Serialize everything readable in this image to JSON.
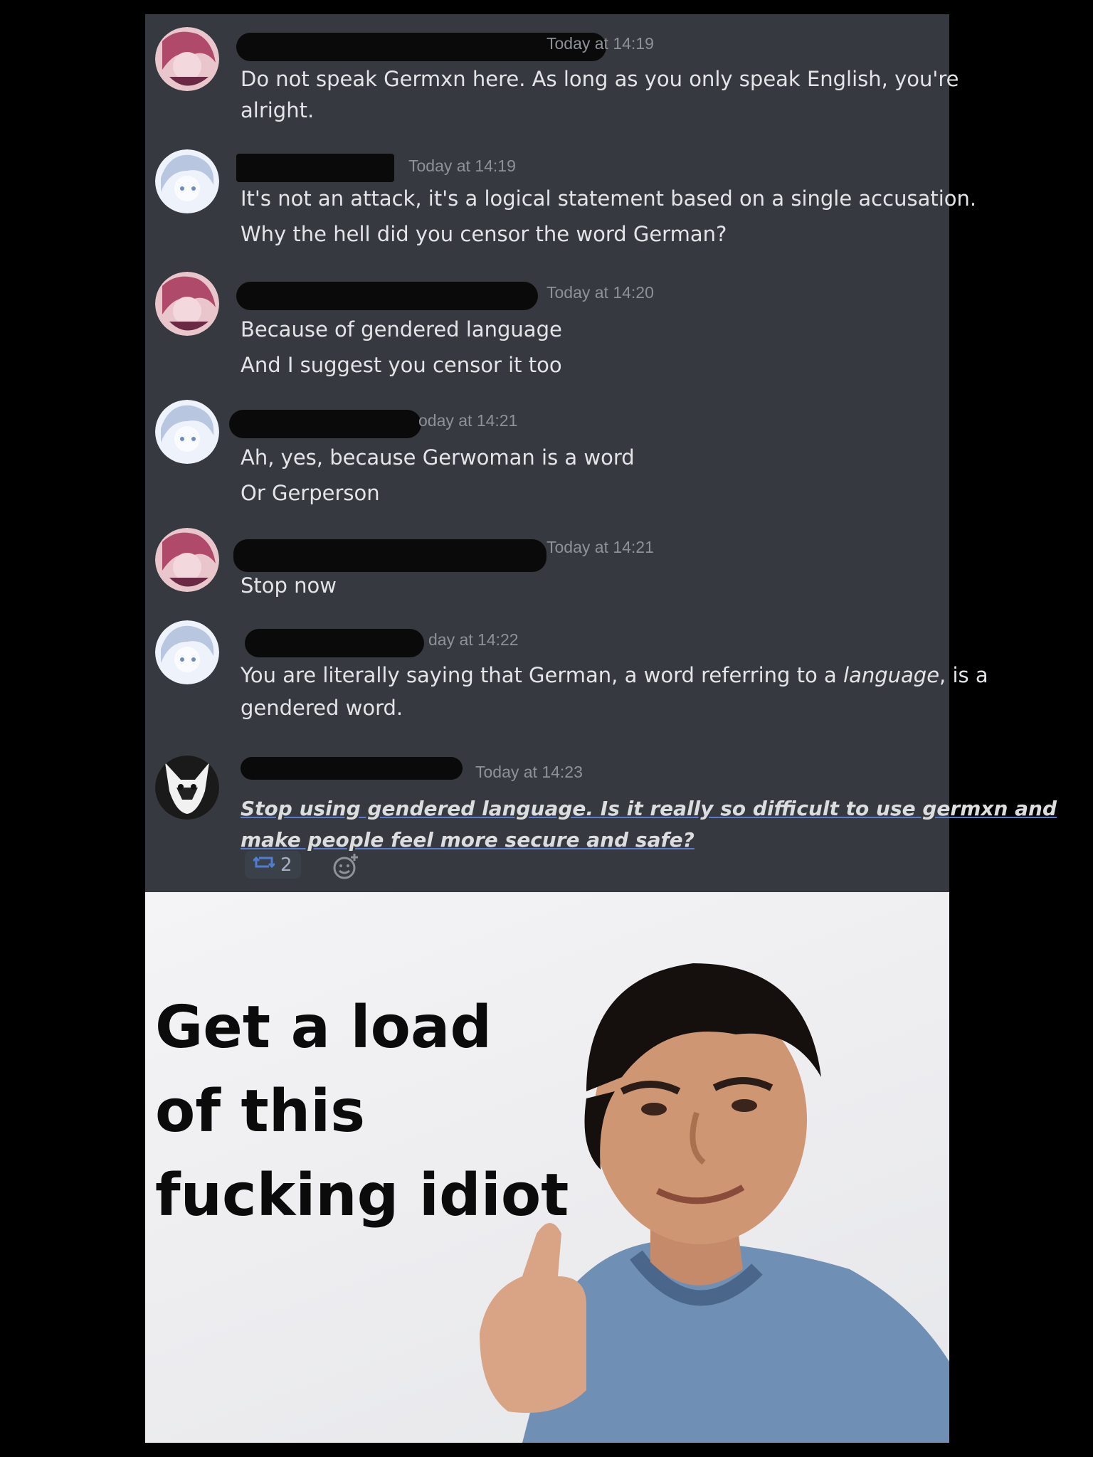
{
  "messages": [
    {
      "author": "redacted",
      "timestamp": "Today at 14:19",
      "lines": [
        "Do not speak Germxn here. As long as you only speak English, you're",
        "alright."
      ]
    },
    {
      "author": "redacted",
      "timestamp": "Today at 14:19",
      "lines": [
        "It's not an attack, it's a logical statement based on a single accusation.",
        "Why the hell did you censor the word German?"
      ]
    },
    {
      "author": "redacted",
      "timestamp": "Today at 14:20",
      "lines": [
        "Because of gendered language",
        "And I suggest you censor it too"
      ]
    },
    {
      "author": "redacted",
      "timestamp": "oday at 14:21",
      "lines": [
        "Ah, yes, because Gerwoman is a word",
        "Or Gerperson"
      ]
    },
    {
      "author": "redacted",
      "timestamp": "Today at 14:21",
      "lines": [
        "Stop now"
      ]
    },
    {
      "author": "redacted",
      "timestamp": "day at 14:22",
      "lines": [
        "You are literally saying that German, a word referring to a language, is a",
        "gendered word."
      ]
    },
    {
      "author": "redacted",
      "timestamp": "Today at 14:23",
      "lines": [
        "Stop using gendered language. Is it really so difficult to use germxn and",
        "make people feel more secure and safe?"
      ]
    }
  ],
  "reaction": {
    "icon": "retweet-icon",
    "count": "2"
  },
  "meme": {
    "caption_lines": [
      "Get a load",
      "of this",
      "fucking idiot"
    ]
  },
  "colors": {
    "chat_bg": "#36393f",
    "timestamp": "#8e9297",
    "text": "#dcddde",
    "accent": "#7289da"
  }
}
